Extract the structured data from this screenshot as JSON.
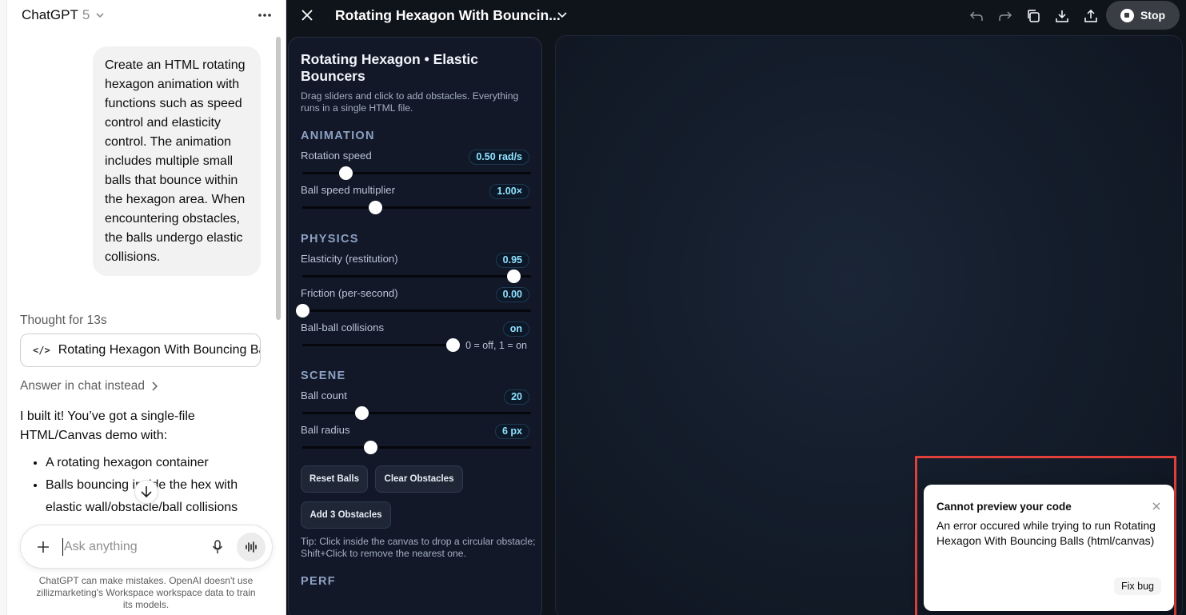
{
  "chat": {
    "model_name": "ChatGPT",
    "model_version": "5",
    "user_message": "Create an HTML rotating\nhexagon animation with\nfunctions such as speed\ncontrol and elasticity\ncontrol. The animation\nincludes multiple small\nballs that bounce within\nthe hexagon area. When\nencountering obstacles,\nthe balls undergo elastic\ncollisions.",
    "thought": "Thought for 13s",
    "artifact_title": "Rotating Hexagon With Bouncing Balls (html/canvas)",
    "answer_link": "Answer in chat instead",
    "reply_intro": "I built it! You’ve got a single-file HTML/Canvas demo with:",
    "reply_bullets": [
      "A rotating hexagon container",
      "Balls bouncing inside the hex with elastic wall/obstacle/ball collisions"
    ],
    "composer_placeholder": "Ask anything",
    "disclaimer": "ChatGPT can make mistakes. OpenAI doesn't use zillizmarketing's Workspace workspace data to train its models."
  },
  "canvas": {
    "title": "Rotating Hexagon With Bouncin...",
    "stop_label": "Stop",
    "panel": {
      "heading": "Rotating Hexagon • Elastic Bouncers",
      "description": "Drag sliders and click to add obstacles. Everything runs in a single HTML file.",
      "sections": {
        "animation": "ANIMATION",
        "physics": "PHYSICS",
        "scene": "SCENE",
        "perf": "PERF"
      },
      "controls": {
        "rotation_speed": {
          "label": "Rotation speed",
          "value": "0.50 rad/s",
          "level": 0.19
        },
        "ball_speed": {
          "label": "Ball speed multiplier",
          "value": "1.00×",
          "level": 0.32
        },
        "elasticity": {
          "label": "Elasticity (restitution)",
          "value": "0.95",
          "level": 0.925
        },
        "friction": {
          "label": "Friction (per-second)",
          "value": "0.00",
          "level": 0.0
        },
        "ball_collisions": {
          "label": "Ball-ball collisions",
          "value": "on",
          "hint": "0 = off, 1 = on",
          "level": 1.0
        },
        "ball_count": {
          "label": "Ball count",
          "value": "20",
          "level": 0.26
        },
        "ball_radius": {
          "label": "Ball radius",
          "value": "6 px",
          "level": 0.3
        }
      },
      "buttons": {
        "reset": "Reset Balls",
        "clear": "Clear Obstacles",
        "add3": "Add 3 Obstacles"
      },
      "tip": "Tip: Click inside the canvas to drop a circular obstacle; Shift+Click to remove the nearest one."
    },
    "error": {
      "title": "Cannot preview your code",
      "message": "An error occured while trying to run Rotating Hexagon With Bouncing Balls (html/canvas)",
      "fix_label": "Fix bug"
    }
  },
  "colors": {
    "accent_value": "#8fe3ff",
    "highlight_box": "#e0403a",
    "panel_bg": "#121827"
  }
}
